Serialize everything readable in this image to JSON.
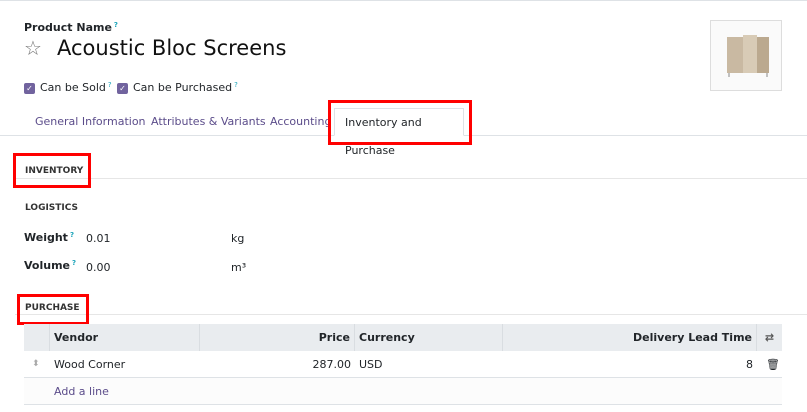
{
  "product": {
    "name_label": "Product Name",
    "help": "?",
    "name": "Acoustic Bloc Screens",
    "can_be_sold": "Can be Sold",
    "can_be_purchased": "Can be Purchased"
  },
  "tabs": [
    {
      "label": "General Information"
    },
    {
      "label": "Attributes & Variants"
    },
    {
      "label": "Accounting"
    },
    {
      "label": "Inventory and Purchase"
    }
  ],
  "inventory": {
    "title": "INVENTORY",
    "logistics": "LOGISTICS",
    "weight_label": "Weight",
    "weight": "0.01",
    "weight_unit": "kg",
    "volume_label": "Volume",
    "volume": "0.00",
    "volume_unit": "m³"
  },
  "purchase": {
    "title": "PURCHASE",
    "headers": {
      "vendor": "Vendor",
      "price": "Price",
      "currency": "Currency",
      "lead": "Delivery Lead Time"
    },
    "rows": [
      {
        "vendor": "Wood Corner",
        "price": "287.00",
        "currency": "USD",
        "lead": "8"
      }
    ],
    "add_line": "Add a line"
  }
}
